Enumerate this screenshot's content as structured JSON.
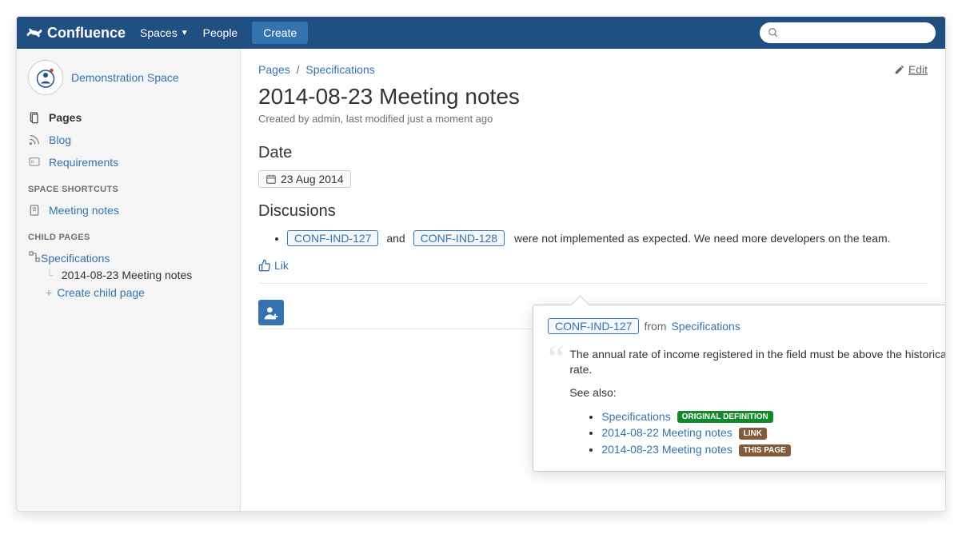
{
  "header": {
    "product": "Confluence",
    "nav": {
      "spaces": "Spaces",
      "people": "People"
    },
    "create_label": "Create",
    "search_placeholder": ""
  },
  "sidebar": {
    "space_name": "Demonstration Space",
    "items": [
      {
        "label": "Pages",
        "icon": "pages-icon",
        "active": true
      },
      {
        "label": "Blog",
        "icon": "rss-icon"
      },
      {
        "label": "Requirements",
        "icon": "requirements-icon"
      }
    ],
    "shortcuts_heading": "SPACE SHORTCUTS",
    "shortcuts": [
      {
        "label": "Meeting notes"
      }
    ],
    "child_heading": "CHILD PAGES",
    "tree": {
      "parent": "Specifications",
      "current": "2014-08-23 Meeting notes",
      "create_child": "Create child page"
    }
  },
  "breadcrumb": {
    "root": "Pages",
    "parent": "Specifications"
  },
  "edit_label": "Edit",
  "page": {
    "title": "2014-08-23 Meeting notes",
    "byline": "Created by admin, last modified just a moment ago",
    "date_heading": "Date",
    "date_value": "23 Aug 2014",
    "discussions_heading": "Discusions",
    "discussion_item": {
      "ref1": "CONF-IND-127",
      "and": "and",
      "ref2": "CONF-IND-128",
      "text": "were not implemented as expected. We need more developers on the team."
    },
    "like_label": "Lik"
  },
  "popover": {
    "ref": "CONF-IND-127",
    "from_label": "from",
    "source": "Specifications",
    "body": "The annual rate of income registered in the field must be above the historical rate.",
    "see_also_label": "See also:",
    "links": [
      {
        "label": "Specifications",
        "badge": "ORIGINAL DEFINITION",
        "badge_color": "green"
      },
      {
        "label": "2014-08-22 Meeting notes",
        "badge": "LINK",
        "badge_color": "brown"
      },
      {
        "label": "2014-08-23 Meeting notes",
        "badge": "THIS PAGE",
        "badge_color": "brown"
      }
    ]
  }
}
